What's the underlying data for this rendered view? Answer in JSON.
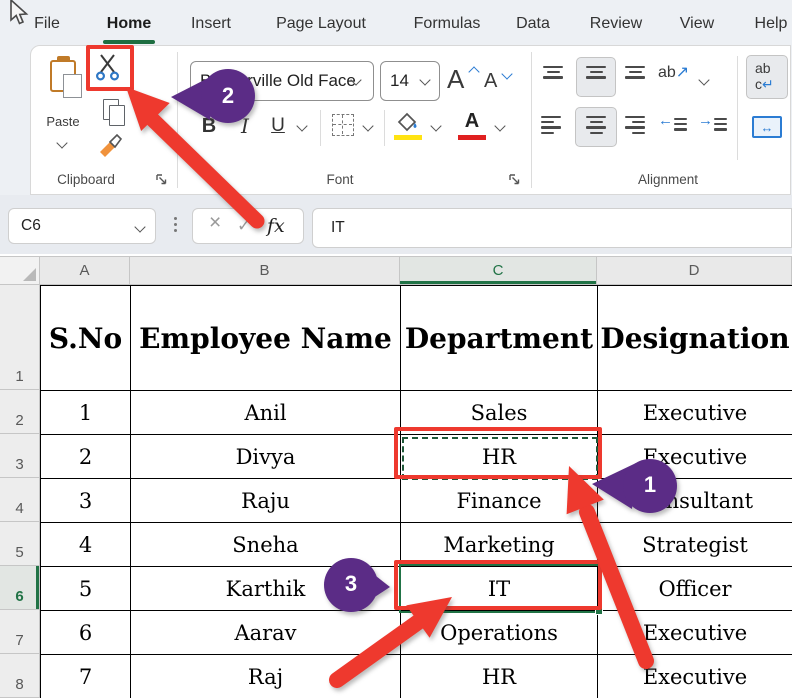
{
  "tabs": [
    "File",
    "Home",
    "Insert",
    "Page Layout",
    "Formulas",
    "Data",
    "Review",
    "View",
    "Help"
  ],
  "active_tab": "Home",
  "ribbon": {
    "clipboard": {
      "paste_label": "Paste",
      "group_label": "Clipboard"
    },
    "font": {
      "font_name": "Baskerville Old Face",
      "font_size": "14",
      "bold_label": "B",
      "italic_label": "I",
      "underline_label": "U",
      "grow_label": "A",
      "shrink_label": "A",
      "font_color_label": "A",
      "group_label": "Font"
    },
    "alignment": {
      "orientation_label": "ab",
      "orientation_arrow": "↗",
      "wrap_line1": "ab",
      "wrap_line2": "c",
      "wrap_arrow": "↵",
      "merge_arrows": "↔",
      "indent_left_arrow": "←",
      "indent_right_arrow": "→",
      "group_label": "Alignment"
    }
  },
  "formula_bar": {
    "name_box": "C6",
    "cancel": "×",
    "accept": "✓",
    "fx": "fx",
    "formula": "IT"
  },
  "grid": {
    "columns": [
      "A",
      "B",
      "C",
      "D"
    ],
    "selected_column": "C",
    "rows": [
      "1",
      "2",
      "3",
      "4",
      "5",
      "6",
      "7",
      "8"
    ],
    "selected_row": "6",
    "table": {
      "headers": [
        "S.No",
        "Employee Name",
        "Department",
        "Designation"
      ],
      "data": [
        [
          "1",
          "Anil",
          "Sales",
          "Executive"
        ],
        [
          "2",
          "Divya",
          "HR",
          "Executive"
        ],
        [
          "3",
          "Raju",
          "Finance",
          "Consultant"
        ],
        [
          "4",
          "Sneha",
          "Marketing",
          "Strategist"
        ],
        [
          "5",
          "Karthik",
          "IT",
          "Officer"
        ],
        [
          "6",
          "Aarav",
          "Operations",
          "Executive"
        ],
        [
          "7",
          "Raj",
          "HR",
          "Executive"
        ]
      ]
    }
  },
  "annotations": {
    "balloon_1": "1",
    "balloon_2": "2",
    "balloon_3": "3",
    "colors": {
      "red": "#ee392e",
      "purple": "#5b2c86",
      "green": "#217346"
    }
  }
}
